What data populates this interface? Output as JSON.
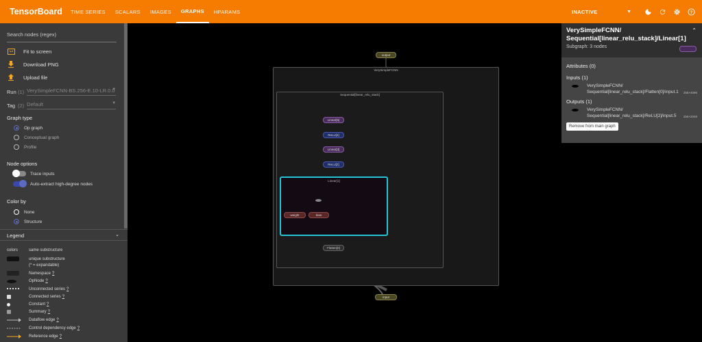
{
  "app": {
    "title": "TensorBoard"
  },
  "tabs": [
    {
      "label": "TIME SERIES"
    },
    {
      "label": "SCALARS"
    },
    {
      "label": "IMAGES"
    },
    {
      "label": "GRAPHS",
      "active": true
    },
    {
      "label": "HPARAMS"
    }
  ],
  "toolbar": {
    "status": "INACTIVE",
    "icons": [
      "dark-mode-icon",
      "refresh-icon",
      "settings-icon",
      "help-icon"
    ]
  },
  "sidebar": {
    "search_placeholder": "Search nodes (regex)",
    "actions": [
      {
        "label": "Fit to screen",
        "icon": "fit-screen-icon"
      },
      {
        "label": "Download PNG",
        "icon": "download-icon"
      },
      {
        "label": "Upload file",
        "icon": "upload-icon"
      }
    ],
    "run": {
      "key": "Run",
      "count": "(1)",
      "value": "VerySimpleFCNN-BS.256-E.10-LR.0.0"
    },
    "tag": {
      "key": "Tag",
      "count": "(2)",
      "value": "Default"
    },
    "graph_type": {
      "title": "Graph type",
      "options": [
        "Op graph",
        "Conceptual graph",
        "Profile"
      ],
      "selected": 0
    },
    "node_options": {
      "title": "Node options",
      "trace_inputs": "Trace inputs",
      "auto_extract": "Auto-extract high-degree nodes"
    },
    "color_by": {
      "title": "Color by",
      "options": [
        "None",
        "Structure"
      ],
      "selected": 1
    }
  },
  "legend": {
    "title": "Legend",
    "colors_key": "colors",
    "colors_value": "same substructure",
    "items": [
      {
        "label": "unique substructure",
        "link": false
      },
      {
        "label": "(* = expandable)",
        "link": false
      },
      {
        "label": "Namespace",
        "link": true
      },
      {
        "label": "OpNode",
        "link": true
      },
      {
        "label": "Unconnected series",
        "link": true
      },
      {
        "label": "Connected series",
        "link": true
      },
      {
        "label": "Constant",
        "link": true
      },
      {
        "label": "Summary",
        "link": true
      },
      {
        "label": "Dataflow edge",
        "link": true
      },
      {
        "label": "Control dependency edge",
        "link": true
      },
      {
        "label": "Reference edge",
        "link": true
      }
    ],
    "link_mark": "?"
  },
  "graph": {
    "outer": "VerySimpleFCNN",
    "inner": "Sequential[linear_relu_stack]",
    "selected_box": "Linear[1]",
    "nodes": {
      "output": "output",
      "linear5": "Linear[5]",
      "relu4": "ReLU[4]",
      "linear3": "Linear[3]",
      "relu2": "ReLU[2]",
      "weight": "weight",
      "bias": "bias",
      "flatten": "Flatten[0]",
      "input": "input"
    },
    "colors": {
      "selection": "#26c6da",
      "linear": "#8a5ca8",
      "relu": "#4a5ab4"
    }
  },
  "info": {
    "title": "VerySimpleFCNN/ Sequential[linear_relu_stack]/Linear[1]",
    "subtitle": "Subgraph: 3 nodes",
    "attributes": "Attributes (0)",
    "inputs_title": "Inputs (1)",
    "input_name": "VerySimpleFCNN/ Sequential[linear_relu_stack]/Flatten[0]/input.1",
    "input_shape": "256×4096",
    "outputs_title": "Outputs (1)",
    "output_name": "VerySimpleFCNN/ Sequential[linear_relu_stack]/ReLU[2]/input.5",
    "output_shape": "256×2048",
    "remove_button": "Remove from main graph"
  }
}
